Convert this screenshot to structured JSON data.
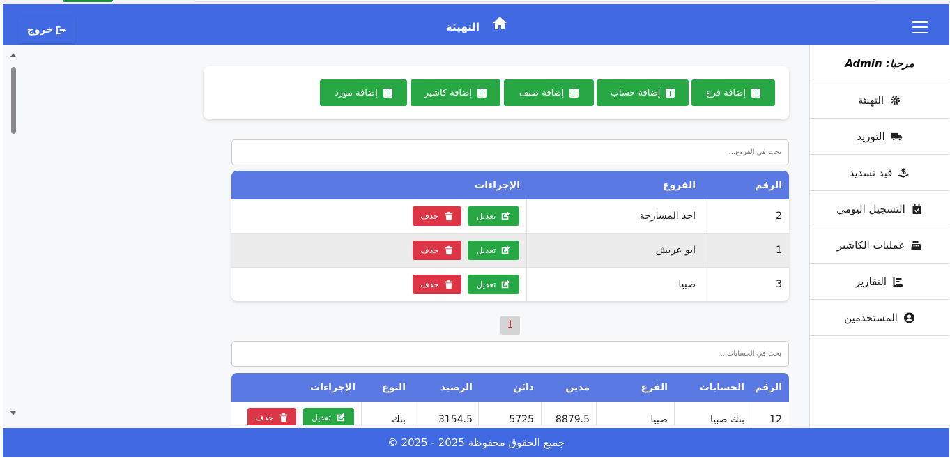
{
  "header": {
    "title": "التهيئة",
    "logout_label": "خروج",
    "icons": {
      "home": "home-icon",
      "menu": "hamburger-menu-icon",
      "logout": "sign-out-icon"
    }
  },
  "sidebar": {
    "welcome": "مرحبا: Admin",
    "items": [
      {
        "label": "التهيئة",
        "icon": "gear-icon"
      },
      {
        "label": "التوريد",
        "icon": "truck-icon"
      },
      {
        "label": "قيد تسديد",
        "icon": "hand-holding-dollar-icon"
      },
      {
        "label": "التسجيل اليومي",
        "icon": "calendar-check-icon"
      },
      {
        "label": "عمليات الكاشير",
        "icon": "cash-register-icon"
      },
      {
        "label": "التقارير",
        "icon": "chart-bar-icon"
      },
      {
        "label": "المستخدمين",
        "icon": "user-circle-icon"
      }
    ]
  },
  "actions": {
    "add_branch": "إضافة فرع",
    "add_account": "إضافة حساب",
    "add_category": "إضافة صنف",
    "add_cashier": "إضافة كاشير",
    "add_supplier": "إضافة مورد"
  },
  "branches": {
    "search_placeholder": "بحث في الفروع...",
    "columns": {
      "number": "الرقم",
      "branch": "الفروع",
      "actions": "الإجراءات"
    },
    "rows": [
      {
        "number": "2",
        "branch": "احد المسارحة"
      },
      {
        "number": "1",
        "branch": "ابو عريش"
      },
      {
        "number": "3",
        "branch": "صبيا"
      }
    ],
    "edit_label": "تعديل",
    "delete_label": "حذف",
    "page": "1"
  },
  "accounts": {
    "search_placeholder": "بحث في الحسابات...",
    "columns": {
      "number": "الرقم",
      "account": "الحسابات",
      "branch": "الفرع",
      "debit": "مدين",
      "credit": "دائن",
      "balance": "الرصيد",
      "type": "النوع",
      "actions": "الإجراءات"
    },
    "rows": [
      {
        "number": "12",
        "account": "بنك صبيا",
        "branch": "صبيا",
        "debit": "8879.5",
        "credit": "5725",
        "balance": "3154.5",
        "type": "بنك"
      }
    ],
    "edit_label": "تعديل",
    "delete_label": "حذف"
  },
  "footer": {
    "text": "جميع الحقوق محفوظة 2025 - 2025 ©"
  },
  "colors": {
    "primary": "#4169e1",
    "success": "#28a745",
    "danger": "#dc3545",
    "table_header": "#5b79e3"
  }
}
